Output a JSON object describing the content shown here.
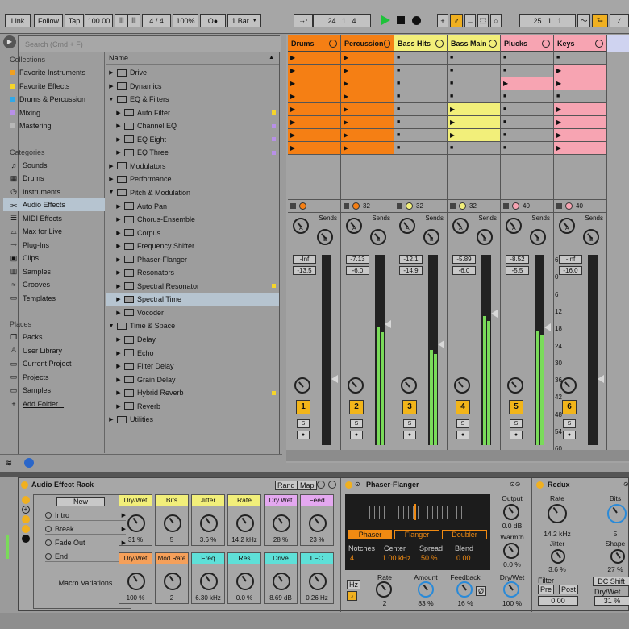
{
  "topbar": {
    "link": "Link",
    "follow": "Follow",
    "tap": "Tap",
    "tempo": "100.00",
    "meter_icon": "||||",
    "meter_icon2": "|||",
    "sig": "4 / 4",
    "zoom": "100%",
    "quant_icon": "O●",
    "bar": "1 Bar",
    "pos1": "24 .  1 .  4",
    "pos2": "25 .  1 .  1",
    "arrow": "→⋅"
  },
  "browser": {
    "search_placeholder": "Search (Cmd + F)",
    "collections_header": "Collections",
    "collections": [
      {
        "label": "Favorite Instruments",
        "color": "#f0a020"
      },
      {
        "label": "Favorite Effects",
        "color": "#f5d52a"
      },
      {
        "label": "Drums & Percussion",
        "color": "#30a8e8"
      },
      {
        "label": "Mixing",
        "color": "#b890e8"
      },
      {
        "label": "Mastering",
        "color": "#b8b8b8"
      }
    ],
    "categories_header": "Categories",
    "categories": [
      {
        "label": "Sounds",
        "icon": "♫"
      },
      {
        "label": "Drums",
        "icon": "▦"
      },
      {
        "label": "Instruments",
        "icon": "◷"
      },
      {
        "label": "Audio Effects",
        "icon": "⫘"
      },
      {
        "label": "MIDI Effects",
        "icon": "☰"
      },
      {
        "label": "Max for Live",
        "icon": "⌓"
      },
      {
        "label": "Plug-Ins",
        "icon": "⊸"
      },
      {
        "label": "Clips",
        "icon": "▣"
      },
      {
        "label": "Samples",
        "icon": "▥"
      },
      {
        "label": "Grooves",
        "icon": "≈"
      },
      {
        "label": "Templates",
        "icon": "▭"
      }
    ],
    "places_header": "Places",
    "places": [
      {
        "label": "Packs",
        "icon": "❐"
      },
      {
        "label": "User Library",
        "icon": "♙"
      },
      {
        "label": "Current Project",
        "icon": "▭"
      },
      {
        "label": "Projects",
        "icon": "▭"
      },
      {
        "label": "Samples",
        "icon": "▭"
      },
      {
        "label": "Add Folder...",
        "icon": "+"
      }
    ],
    "name_header": "Name",
    "files": [
      {
        "label": "Drive",
        "lvl": 0,
        "open": false
      },
      {
        "label": "Dynamics",
        "lvl": 0,
        "open": false
      },
      {
        "label": "EQ & Filters",
        "lvl": 0,
        "open": true
      },
      {
        "label": "Auto Filter",
        "lvl": 1,
        "dot": "#f5d52a"
      },
      {
        "label": "Channel EQ",
        "lvl": 1,
        "dot": "#b890e8"
      },
      {
        "label": "EQ Eight",
        "lvl": 1,
        "dot": "#b890e8"
      },
      {
        "label": "EQ Three",
        "lvl": 1,
        "dot": "#b890e8"
      },
      {
        "label": "Modulators",
        "lvl": 0,
        "open": false
      },
      {
        "label": "Performance",
        "lvl": 0,
        "open": false
      },
      {
        "label": "Pitch & Modulation",
        "lvl": 0,
        "open": true
      },
      {
        "label": "Auto Pan",
        "lvl": 1
      },
      {
        "label": "Chorus-Ensemble",
        "lvl": 1
      },
      {
        "label": "Corpus",
        "lvl": 1
      },
      {
        "label": "Frequency Shifter",
        "lvl": 1
      },
      {
        "label": "Phaser-Flanger",
        "lvl": 1
      },
      {
        "label": "Resonators",
        "lvl": 1
      },
      {
        "label": "Spectral Resonator",
        "lvl": 1,
        "dot": "#f5d52a"
      },
      {
        "label": "Spectral Time",
        "lvl": 1,
        "sel": true
      },
      {
        "label": "Vocoder",
        "lvl": 1
      },
      {
        "label": "Time & Space",
        "lvl": 0,
        "open": true
      },
      {
        "label": "Delay",
        "lvl": 1
      },
      {
        "label": "Echo",
        "lvl": 1
      },
      {
        "label": "Filter Delay",
        "lvl": 1
      },
      {
        "label": "Grain Delay",
        "lvl": 1
      },
      {
        "label": "Hybrid Reverb",
        "lvl": 1,
        "dot": "#f5d52a"
      },
      {
        "label": "Reverb",
        "lvl": 1
      },
      {
        "label": "Utilities",
        "lvl": 0,
        "open": false
      }
    ]
  },
  "tracks": [
    {
      "name": "Drums",
      "color": "#f57f14",
      "vol": "-Inf",
      "vol2": "-13.5",
      "num": "1",
      "count": "",
      "meter": 0
    },
    {
      "name": "Percussion",
      "color": "#f57f14",
      "vol": "-7.13",
      "vol2": "-6.0",
      "num": "2",
      "count": "32",
      "meter": 0.62
    },
    {
      "name": "Bass Hits",
      "color": "#f2ef7a",
      "vol": "-12.1",
      "vol2": "-14.9",
      "num": "3",
      "count": "32",
      "meter": 0.5
    },
    {
      "name": "Bass Main",
      "color": "#f2ef7a",
      "vol": "-5.89",
      "vol2": "-6.0",
      "num": "4",
      "count": "32",
      "meter": 0.68
    },
    {
      "name": "Plucks",
      "color": "#f7a4b2",
      "vol": "-8.52",
      "vol2": "-5.5",
      "num": "5",
      "count": "40",
      "meter": 0.6
    },
    {
      "name": "Keys",
      "color": "#f7a4b2",
      "vol": "-Inf",
      "vol2": "-16.0",
      "num": "6",
      "count": "40",
      "meter": 0
    }
  ],
  "sends_label": "Sends",
  "send_a": "A",
  "send_b": "B",
  "solo": "S",
  "scale": [
    "6",
    "0",
    "6",
    "12",
    "18",
    "24",
    "30",
    "36",
    "42",
    "48",
    "54",
    "60"
  ],
  "rack": {
    "title": "Audio Effect Rack",
    "rand": "Rand",
    "map": "Map",
    "new": "New",
    "variations": [
      "Intro",
      "Break",
      "Fade Out",
      "End"
    ],
    "macro_variations": "Macro Variations",
    "macros": [
      {
        "label": "Dry/Wet",
        "val": "31 %",
        "color": "#f2ef7a"
      },
      {
        "label": "Bits",
        "val": "5",
        "color": "#f2ef7a"
      },
      {
        "label": "Jitter",
        "val": "3.6 %",
        "color": "#f2ef7a"
      },
      {
        "label": "Rate",
        "val": "14.2 kHz",
        "color": "#f2ef7a"
      },
      {
        "label": "Dry Wet",
        "val": "28 %",
        "color": "#e4a8f0"
      },
      {
        "label": "Feed",
        "val": "23 %",
        "color": "#e4a8f0"
      },
      {
        "label": "Dry/Wet",
        "val": "100 %",
        "color": "#f5a05a"
      },
      {
        "label": "Mod Rate",
        "val": "2",
        "color": "#f5a05a"
      },
      {
        "label": "Freq",
        "val": "6.30 kHz",
        "color": "#5ee0d8"
      },
      {
        "label": "Res",
        "val": "0.0 %",
        "color": "#5ee0d8"
      },
      {
        "label": "Drive",
        "val": "8.69 dB",
        "color": "#5ee0d8"
      },
      {
        "label": "LFO",
        "val": "0.26 Hz",
        "color": "#5ee0d8"
      }
    ]
  },
  "phaser": {
    "title": "Phaser-Flanger",
    "modes": [
      "Phaser",
      "Flanger",
      "Doubler"
    ],
    "notches_l": "Notches",
    "notches": "4",
    "center_l": "Center",
    "center": "1.00 kHz",
    "spread_l": "Spread",
    "spread": "50 %",
    "blend_l": "Blend",
    "blend": "0.00",
    "output_l": "Output",
    "output": "0.0 dB",
    "warmth_l": "Warmth",
    "warmth": "0.0 %",
    "drywet_l": "Dry/Wet",
    "drywet": "100 %",
    "rate_l": "Rate",
    "rate": "2",
    "amount_l": "Amount",
    "amount": "83 %",
    "feedback_l": "Feedback",
    "feedback": "16 %",
    "hz": "Hz",
    "note": "♪",
    "phi": "Ø"
  },
  "redux": {
    "title": "Redux",
    "rate_l": "Rate",
    "rate": "14.2 kHz",
    "jitter_l": "Jitter",
    "jitter": "3.6 %",
    "filter_l": "Filter",
    "pre": "Pre",
    "post": "Post",
    "filter_val": "0.00",
    "bits_l": "Bits",
    "bits": "5",
    "shape_l": "Shape",
    "shape": "27 %",
    "dc": "DC Shift",
    "drywet_l": "Dry/Wet",
    "drywet": "31 %"
  }
}
